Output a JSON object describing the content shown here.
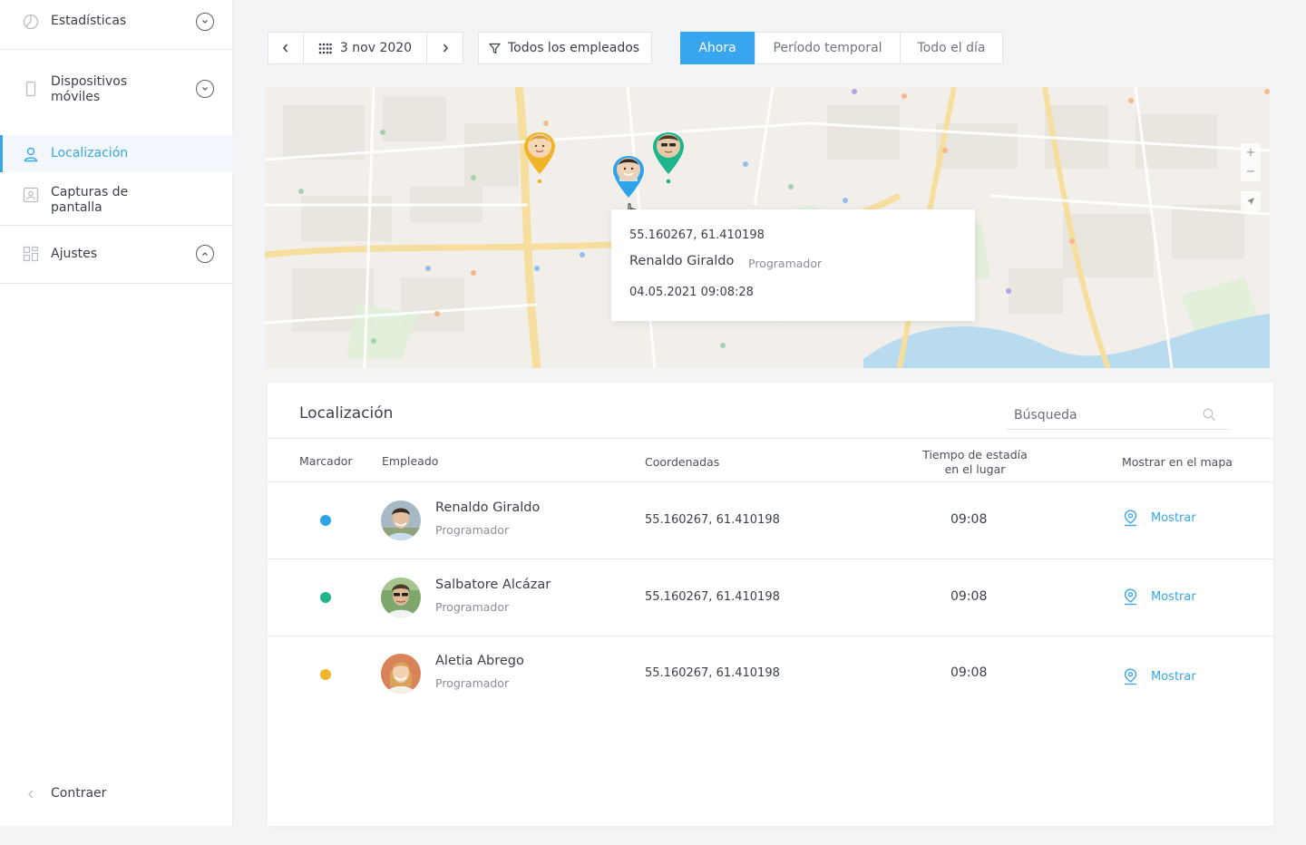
{
  "sidebar": {
    "items": [
      {
        "label": "Estadísticas"
      },
      {
        "label": "Dispositivos móviles"
      },
      {
        "label": "Localización"
      },
      {
        "label": "Capturas de pantalla"
      },
      {
        "label": "Ajustes"
      }
    ],
    "collapse_label": "Contraer"
  },
  "toolbar": {
    "date": "3 nov 2020",
    "filter": "Todos los empleados",
    "segments": [
      "Ahora",
      "Período temporal",
      "Todo el día"
    ]
  },
  "popup": {
    "coords": "55.160267, 61.410198",
    "name": "Renaldo Giraldo",
    "role": "Programador",
    "time": "04.05.2021 09:08:28"
  },
  "panel": {
    "title": "Localización",
    "search_placeholder": "Búsqueda",
    "columns": [
      "Marcador",
      "Empleado",
      "Coordenadas",
      "Tiempo de estadía",
      "en el lugar",
      "Mostrar en el mapa"
    ],
    "rows": [
      {
        "name": "Renaldo Giraldo",
        "role": "Programador",
        "coords": "55.160267, 61.410198",
        "time": "09:08",
        "action": "Mostrar",
        "marker": "#2fa3ea"
      },
      {
        "name": "Salbatore Alcázar",
        "role": "Programador",
        "coords": "55.160267, 61.410198",
        "time": "09:08",
        "action": "Mostrar",
        "marker": "#1db58a"
      },
      {
        "name": "Aletia Abrego",
        "role": "Programador",
        "coords": "55.160267, 61.410198",
        "time": "09:08",
        "action": "Mostrar",
        "marker": "#f0b429"
      }
    ]
  },
  "colors": {
    "accent": "#38a6ef",
    "blue": "#2fa3ea",
    "green": "#1db58a",
    "yellow": "#f0b429"
  }
}
